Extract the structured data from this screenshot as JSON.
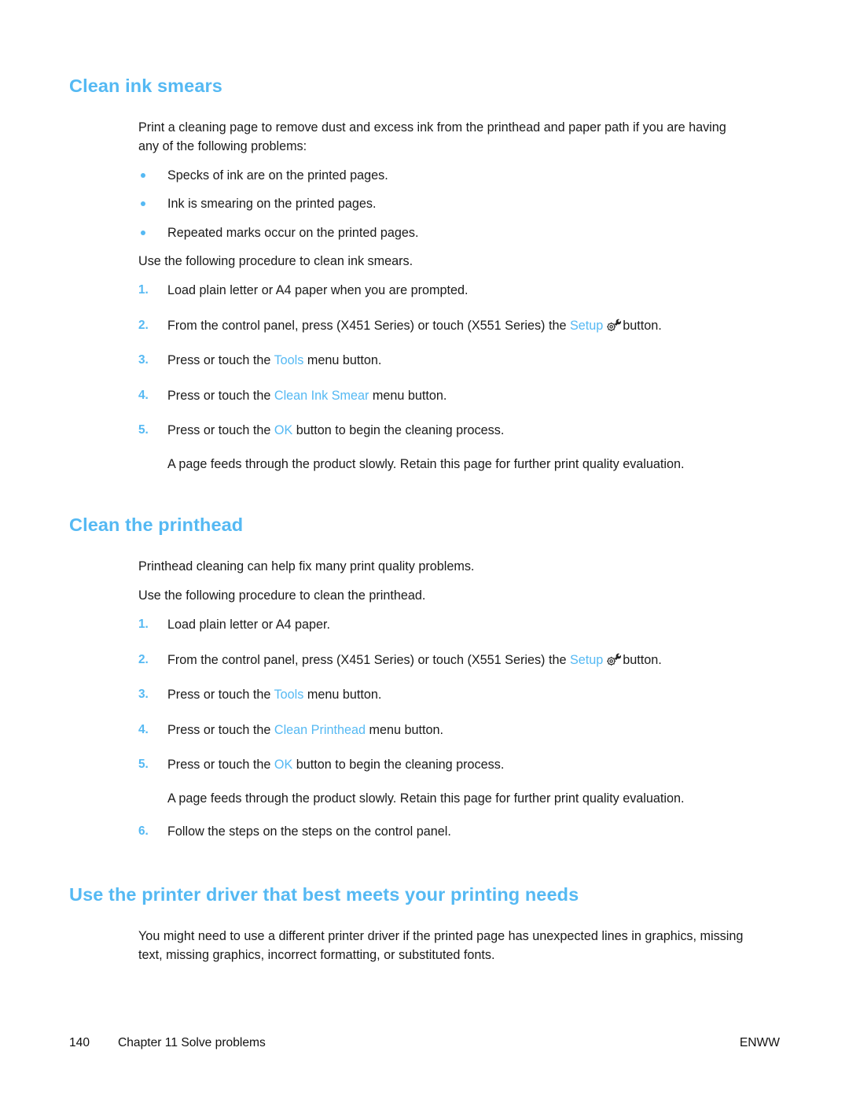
{
  "colors": {
    "heading_blue": "#55b9f3",
    "term_blue": "#55b9f3",
    "bullet_blue": "#55b9f3",
    "body_text": "#1a1a1a"
  },
  "sections": [
    {
      "heading": "Clean ink smears",
      "intro": "Print a cleaning page to remove dust and excess ink from the printhead and paper path if you are having any of the following problems:",
      "bullets": [
        "Specks of ink are on the printed pages.",
        "Ink is smearing on the printed pages.",
        "Repeated marks occur on the printed pages."
      ],
      "procedure_lead": "Use the following procedure to clean ink smears.",
      "steps": [
        {
          "number": "1.",
          "parts": [
            {
              "type": "text",
              "value": "Load plain letter or A4 paper when you are prompted."
            }
          ]
        },
        {
          "number": "2.",
          "parts": [
            {
              "type": "text",
              "value": "From the control panel, press (X451 Series) or touch (X551 Series) the "
            },
            {
              "type": "term",
              "value": "Setup"
            },
            {
              "type": "icon",
              "value": "setup-gear-wrench-icon"
            },
            {
              "type": "text",
              "value": "button."
            }
          ]
        },
        {
          "number": "3.",
          "parts": [
            {
              "type": "text",
              "value": "Press or touch the "
            },
            {
              "type": "term",
              "value": "Tools"
            },
            {
              "type": "text",
              "value": " menu button."
            }
          ]
        },
        {
          "number": "4.",
          "parts": [
            {
              "type": "text",
              "value": "Press or touch the "
            },
            {
              "type": "term",
              "value": "Clean Ink Smear"
            },
            {
              "type": "text",
              "value": " menu button."
            }
          ]
        },
        {
          "number": "5.",
          "parts": [
            {
              "type": "text",
              "value": "Press or touch the "
            },
            {
              "type": "term",
              "value": "OK"
            },
            {
              "type": "text",
              "value": " button to begin the cleaning process."
            }
          ],
          "note": "A page feeds through the product slowly. Retain this page for further print quality evaluation."
        }
      ]
    },
    {
      "heading": "Clean the printhead",
      "intro": "Printhead cleaning can help fix many print quality problems.",
      "procedure_lead": "Use the following procedure to clean the printhead.",
      "steps": [
        {
          "number": "1.",
          "parts": [
            {
              "type": "text",
              "value": "Load plain letter or A4 paper."
            }
          ]
        },
        {
          "number": "2.",
          "parts": [
            {
              "type": "text",
              "value": "From the control panel, press (X451 Series) or touch (X551 Series) the "
            },
            {
              "type": "term",
              "value": "Setup"
            },
            {
              "type": "icon",
              "value": "setup-gear-wrench-icon"
            },
            {
              "type": "text",
              "value": "button."
            }
          ]
        },
        {
          "number": "3.",
          "parts": [
            {
              "type": "text",
              "value": "Press or touch the "
            },
            {
              "type": "term",
              "value": "Tools"
            },
            {
              "type": "text",
              "value": " menu button."
            }
          ]
        },
        {
          "number": "4.",
          "parts": [
            {
              "type": "text",
              "value": "Press or touch the "
            },
            {
              "type": "term",
              "value": "Clean Printhead"
            },
            {
              "type": "text",
              "value": " menu button."
            }
          ]
        },
        {
          "number": "5.",
          "parts": [
            {
              "type": "text",
              "value": "Press or touch the "
            },
            {
              "type": "term",
              "value": "OK"
            },
            {
              "type": "text",
              "value": " button to begin the cleaning process."
            }
          ],
          "note": "A page feeds through the product slowly. Retain this page for further print quality evaluation."
        },
        {
          "number": "6.",
          "parts": [
            {
              "type": "text",
              "value": "Follow the steps on the steps on the control panel."
            }
          ]
        }
      ]
    },
    {
      "heading": "Use the printer driver that best meets your printing needs",
      "intro": "You might need to use a different printer driver if the printed page has unexpected lines in graphics, missing text, missing graphics, incorrect formatting, or substituted fonts."
    }
  ],
  "footer": {
    "page_number": "140",
    "chapter": "Chapter 11  Solve problems",
    "locale": "ENWW"
  }
}
